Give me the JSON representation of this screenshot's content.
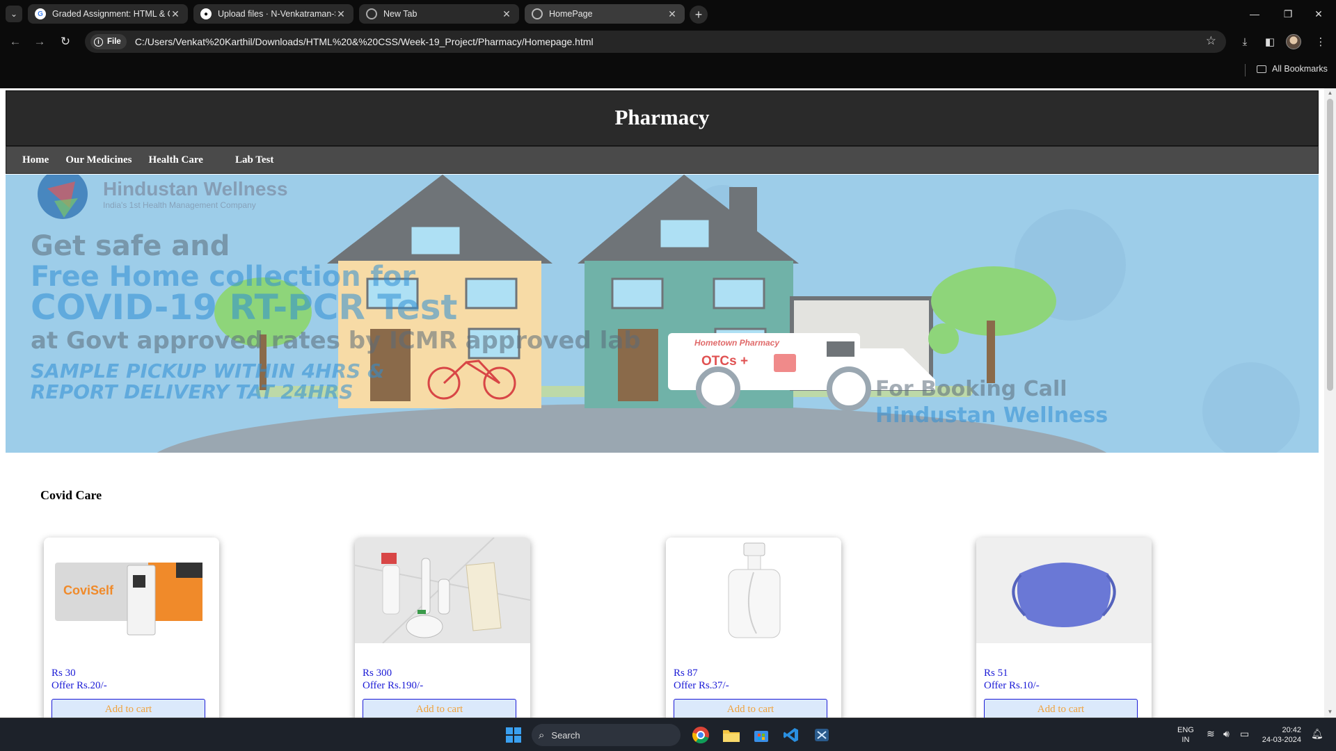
{
  "browser": {
    "tabs": [
      {
        "label": "Graded Assignment: HTML & C",
        "icon": "google-g-icon"
      },
      {
        "label": "Upload files · N-Venkatraman-S",
        "icon": "github-icon"
      },
      {
        "label": "New Tab",
        "icon": "chrome-icon"
      },
      {
        "label": "HomePage",
        "icon": "globe-icon"
      }
    ],
    "site_chip": "File",
    "url": "C:/Users/Venkat%20Karthil/Downloads/HTML%20&%20CSS/Week-19_Project/Pharmacy/Homepage.html",
    "bookmarks_label": "All Bookmarks"
  },
  "site": {
    "title": "Pharmacy",
    "nav": [
      "Home",
      "Our Medicines",
      "Health Care",
      "Lab Test"
    ],
    "banner": {
      "brand": "Hindustan Wellness",
      "tagline": "India's 1st Health Management Company",
      "line1": "Get safe and",
      "line2": "Free Home collection for",
      "line3": "COVID-19 RT-PCR Test",
      "line4": "at Govt approved rates by ICMR approved lab",
      "line5": "SAMPLE PICKUP WITHIN 4HRS &",
      "line6": "REPORT DELIVERY TAT 24HRS",
      "truck_label": "Hometown Pharmacy",
      "truck_otc": "OTCs +",
      "booking1": "For Booking Call",
      "booking2": "Hindustan Wellness"
    },
    "section_title": "Covid Care",
    "products": [
      {
        "image": "covid-antigen-test-kit",
        "kit_text": "CoviSelf",
        "price": "Rs 30",
        "offer": "Offer Rs.20/-",
        "button": "Add to cart"
      },
      {
        "image": "covid-kit-sanitizer-thermometer-gloves-mask",
        "price": "Rs 300",
        "offer": "Offer Rs.190/-",
        "button": "Add to cart"
      },
      {
        "image": "spray-bottle",
        "price": "Rs 87",
        "offer": "Offer Rs.37/-",
        "button": "Add to cart"
      },
      {
        "image": "blue-face-mask",
        "price": "Rs 51",
        "offer": "Offer Rs.10/-",
        "button": "Add to cart"
      }
    ]
  },
  "taskbar": {
    "search_placeholder": "Search",
    "lang_line1": "ENG",
    "lang_line2": "IN",
    "time": "20:42",
    "date": "24-03-2024"
  },
  "colors": {
    "header_bg": "#2a2a2a",
    "nav_bg": "#4a4a4a",
    "price_text": "#1a1ad6",
    "button_text": "#f0a23c",
    "button_bg": "#dbe9fb"
  }
}
